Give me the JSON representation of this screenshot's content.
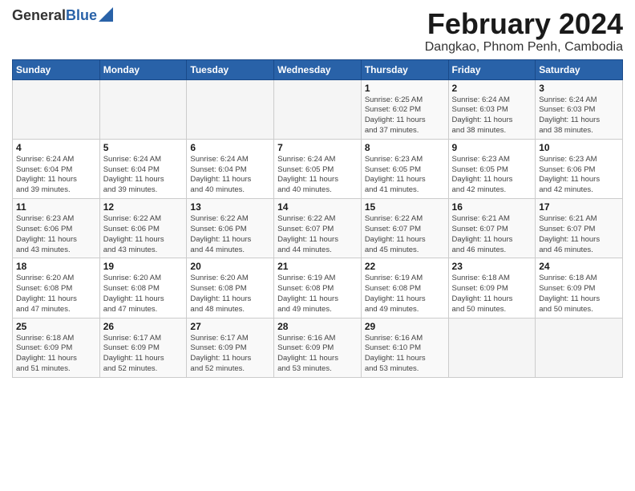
{
  "header": {
    "logo_general": "General",
    "logo_blue": "Blue",
    "title": "February 2024",
    "subtitle": "Dangkao, Phnom Penh, Cambodia"
  },
  "days_of_week": [
    "Sunday",
    "Monday",
    "Tuesday",
    "Wednesday",
    "Thursday",
    "Friday",
    "Saturday"
  ],
  "weeks": [
    [
      {
        "num": "",
        "info": ""
      },
      {
        "num": "",
        "info": ""
      },
      {
        "num": "",
        "info": ""
      },
      {
        "num": "",
        "info": ""
      },
      {
        "num": "1",
        "info": "Sunrise: 6:25 AM\nSunset: 6:02 PM\nDaylight: 11 hours\nand 37 minutes."
      },
      {
        "num": "2",
        "info": "Sunrise: 6:24 AM\nSunset: 6:03 PM\nDaylight: 11 hours\nand 38 minutes."
      },
      {
        "num": "3",
        "info": "Sunrise: 6:24 AM\nSunset: 6:03 PM\nDaylight: 11 hours\nand 38 minutes."
      }
    ],
    [
      {
        "num": "4",
        "info": "Sunrise: 6:24 AM\nSunset: 6:04 PM\nDaylight: 11 hours\nand 39 minutes."
      },
      {
        "num": "5",
        "info": "Sunrise: 6:24 AM\nSunset: 6:04 PM\nDaylight: 11 hours\nand 39 minutes."
      },
      {
        "num": "6",
        "info": "Sunrise: 6:24 AM\nSunset: 6:04 PM\nDaylight: 11 hours\nand 40 minutes."
      },
      {
        "num": "7",
        "info": "Sunrise: 6:24 AM\nSunset: 6:05 PM\nDaylight: 11 hours\nand 40 minutes."
      },
      {
        "num": "8",
        "info": "Sunrise: 6:23 AM\nSunset: 6:05 PM\nDaylight: 11 hours\nand 41 minutes."
      },
      {
        "num": "9",
        "info": "Sunrise: 6:23 AM\nSunset: 6:05 PM\nDaylight: 11 hours\nand 42 minutes."
      },
      {
        "num": "10",
        "info": "Sunrise: 6:23 AM\nSunset: 6:06 PM\nDaylight: 11 hours\nand 42 minutes."
      }
    ],
    [
      {
        "num": "11",
        "info": "Sunrise: 6:23 AM\nSunset: 6:06 PM\nDaylight: 11 hours\nand 43 minutes."
      },
      {
        "num": "12",
        "info": "Sunrise: 6:22 AM\nSunset: 6:06 PM\nDaylight: 11 hours\nand 43 minutes."
      },
      {
        "num": "13",
        "info": "Sunrise: 6:22 AM\nSunset: 6:06 PM\nDaylight: 11 hours\nand 44 minutes."
      },
      {
        "num": "14",
        "info": "Sunrise: 6:22 AM\nSunset: 6:07 PM\nDaylight: 11 hours\nand 44 minutes."
      },
      {
        "num": "15",
        "info": "Sunrise: 6:22 AM\nSunset: 6:07 PM\nDaylight: 11 hours\nand 45 minutes."
      },
      {
        "num": "16",
        "info": "Sunrise: 6:21 AM\nSunset: 6:07 PM\nDaylight: 11 hours\nand 46 minutes."
      },
      {
        "num": "17",
        "info": "Sunrise: 6:21 AM\nSunset: 6:07 PM\nDaylight: 11 hours\nand 46 minutes."
      }
    ],
    [
      {
        "num": "18",
        "info": "Sunrise: 6:20 AM\nSunset: 6:08 PM\nDaylight: 11 hours\nand 47 minutes."
      },
      {
        "num": "19",
        "info": "Sunrise: 6:20 AM\nSunset: 6:08 PM\nDaylight: 11 hours\nand 47 minutes."
      },
      {
        "num": "20",
        "info": "Sunrise: 6:20 AM\nSunset: 6:08 PM\nDaylight: 11 hours\nand 48 minutes."
      },
      {
        "num": "21",
        "info": "Sunrise: 6:19 AM\nSunset: 6:08 PM\nDaylight: 11 hours\nand 49 minutes."
      },
      {
        "num": "22",
        "info": "Sunrise: 6:19 AM\nSunset: 6:08 PM\nDaylight: 11 hours\nand 49 minutes."
      },
      {
        "num": "23",
        "info": "Sunrise: 6:18 AM\nSunset: 6:09 PM\nDaylight: 11 hours\nand 50 minutes."
      },
      {
        "num": "24",
        "info": "Sunrise: 6:18 AM\nSunset: 6:09 PM\nDaylight: 11 hours\nand 50 minutes."
      }
    ],
    [
      {
        "num": "25",
        "info": "Sunrise: 6:18 AM\nSunset: 6:09 PM\nDaylight: 11 hours\nand 51 minutes."
      },
      {
        "num": "26",
        "info": "Sunrise: 6:17 AM\nSunset: 6:09 PM\nDaylight: 11 hours\nand 52 minutes."
      },
      {
        "num": "27",
        "info": "Sunrise: 6:17 AM\nSunset: 6:09 PM\nDaylight: 11 hours\nand 52 minutes."
      },
      {
        "num": "28",
        "info": "Sunrise: 6:16 AM\nSunset: 6:09 PM\nDaylight: 11 hours\nand 53 minutes."
      },
      {
        "num": "29",
        "info": "Sunrise: 6:16 AM\nSunset: 6:10 PM\nDaylight: 11 hours\nand 53 minutes."
      },
      {
        "num": "",
        "info": ""
      },
      {
        "num": "",
        "info": ""
      }
    ]
  ]
}
